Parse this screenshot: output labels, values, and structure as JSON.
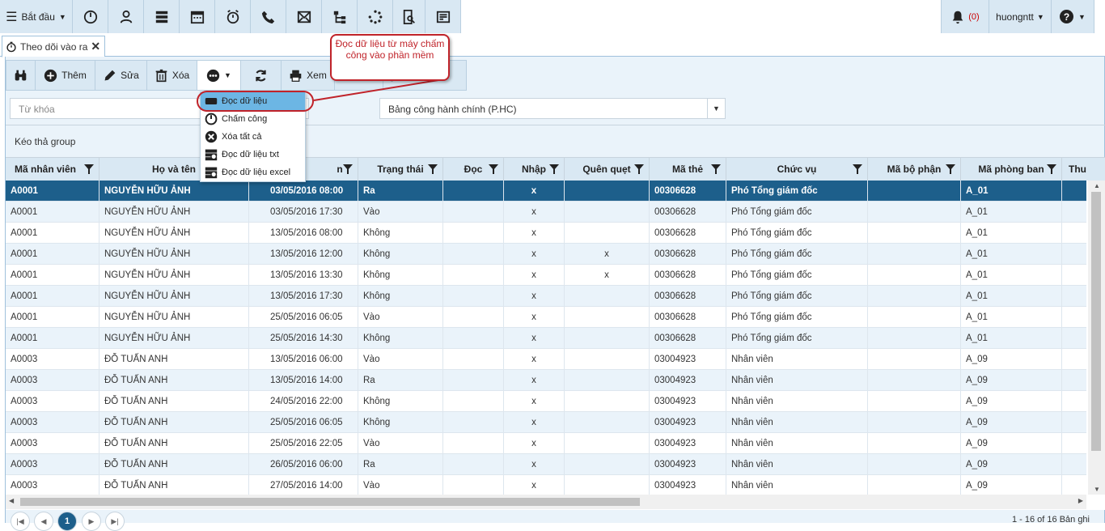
{
  "topbar": {
    "start_label": "Bắt đầu",
    "notification_count": "(0)",
    "user": "huongntt",
    "help": "?"
  },
  "tabs": [
    {
      "label": "Theo dõi vào ra"
    }
  ],
  "toolbar": {
    "add_label": "Thêm",
    "edit_label": "Sửa",
    "delete_label": "Xóa",
    "view_label": "Xem"
  },
  "search": {
    "keyword_placeholder": "Từ khóa",
    "timesheet_select": "Bảng công hành chính (P.HC)"
  },
  "group_area_label": "Kéo thả group",
  "dropdown": {
    "items": [
      {
        "label": "Đọc dữ liệu",
        "icon": "device-icon"
      },
      {
        "label": "Chấm công",
        "icon": "clock-icon"
      },
      {
        "label": "Xóa tất cả",
        "icon": "close-circle-icon"
      },
      {
        "label": "Đọc dữ liệu txt",
        "icon": "database-icon"
      },
      {
        "label": "Đọc dữ liệu excel",
        "icon": "database-icon"
      }
    ]
  },
  "callout": {
    "text": "Đọc dữ liệu từ máy chấm công vào phần mềm"
  },
  "grid": {
    "columns": [
      "Mã nhân viên",
      "Họ và tên",
      "",
      "Trạng thái",
      "Đọc",
      "Nhập",
      "Quên quẹt",
      "Mã thẻ",
      "Chức vụ",
      "Mã bộ phận",
      "Mã phòng ban",
      "Thu"
    ],
    "partial_col_suffix": "n",
    "rows": [
      [
        "A0001",
        "NGUYỄN HỮU ẢNH",
        "03/05/2016 08:00",
        "Ra",
        "",
        "x",
        "",
        "00306628",
        "Phó Tổng giám đốc",
        "",
        "A_01"
      ],
      [
        "A0001",
        "NGUYỄN HỮU ẢNH",
        "03/05/2016 17:30",
        "Vào",
        "",
        "x",
        "",
        "00306628",
        "Phó Tổng giám đốc",
        "",
        "A_01"
      ],
      [
        "A0001",
        "NGUYỄN HỮU ẢNH",
        "13/05/2016 08:00",
        "Không",
        "",
        "x",
        "",
        "00306628",
        "Phó Tổng giám đốc",
        "",
        "A_01"
      ],
      [
        "A0001",
        "NGUYỄN HỮU ẢNH",
        "13/05/2016 12:00",
        "Không",
        "",
        "x",
        "x",
        "00306628",
        "Phó Tổng giám đốc",
        "",
        "A_01"
      ],
      [
        "A0001",
        "NGUYỄN HỮU ẢNH",
        "13/05/2016 13:30",
        "Không",
        "",
        "x",
        "x",
        "00306628",
        "Phó Tổng giám đốc",
        "",
        "A_01"
      ],
      [
        "A0001",
        "NGUYỄN HỮU ẢNH",
        "13/05/2016 17:30",
        "Không",
        "",
        "x",
        "",
        "00306628",
        "Phó Tổng giám đốc",
        "",
        "A_01"
      ],
      [
        "A0001",
        "NGUYỄN HỮU ẢNH",
        "25/05/2016 06:05",
        "Vào",
        "",
        "x",
        "",
        "00306628",
        "Phó Tổng giám đốc",
        "",
        "A_01"
      ],
      [
        "A0001",
        "NGUYỄN HỮU ẢNH",
        "25/05/2016 14:30",
        "Không",
        "",
        "x",
        "",
        "00306628",
        "Phó Tổng giám đốc",
        "",
        "A_01"
      ],
      [
        "A0003",
        "ĐỖ TUẤN ANH",
        "13/05/2016 06:00",
        "Vào",
        "",
        "x",
        "",
        "03004923",
        "Nhân viên",
        "",
        "A_09"
      ],
      [
        "A0003",
        "ĐỖ TUẤN ANH",
        "13/05/2016 14:00",
        "Ra",
        "",
        "x",
        "",
        "03004923",
        "Nhân viên",
        "",
        "A_09"
      ],
      [
        "A0003",
        "ĐỖ TUẤN ANH",
        "24/05/2016 22:00",
        "Không",
        "",
        "x",
        "",
        "03004923",
        "Nhân viên",
        "",
        "A_09"
      ],
      [
        "A0003",
        "ĐỖ TUẤN ANH",
        "25/05/2016 06:05",
        "Không",
        "",
        "x",
        "",
        "03004923",
        "Nhân viên",
        "",
        "A_09"
      ],
      [
        "A0003",
        "ĐỖ TUẤN ANH",
        "25/05/2016 22:05",
        "Vào",
        "",
        "x",
        "",
        "03004923",
        "Nhân viên",
        "",
        "A_09"
      ],
      [
        "A0003",
        "ĐỖ TUẤN ANH",
        "26/05/2016 06:00",
        "Ra",
        "",
        "x",
        "",
        "03004923",
        "Nhân viên",
        "",
        "A_09"
      ],
      [
        "A0003",
        "ĐỖ TUẤN ANH",
        "27/05/2016 14:00",
        "Vào",
        "",
        "x",
        "",
        "03004923",
        "Nhân viên",
        "",
        "A_09"
      ]
    ]
  },
  "pager": {
    "current": "1",
    "info": "1 - 16 of 16 Bản ghi"
  },
  "colors": {
    "accent": "#1d5f8b",
    "toolbar_bg": "#d9e8f3",
    "callout": "#c0232a"
  }
}
